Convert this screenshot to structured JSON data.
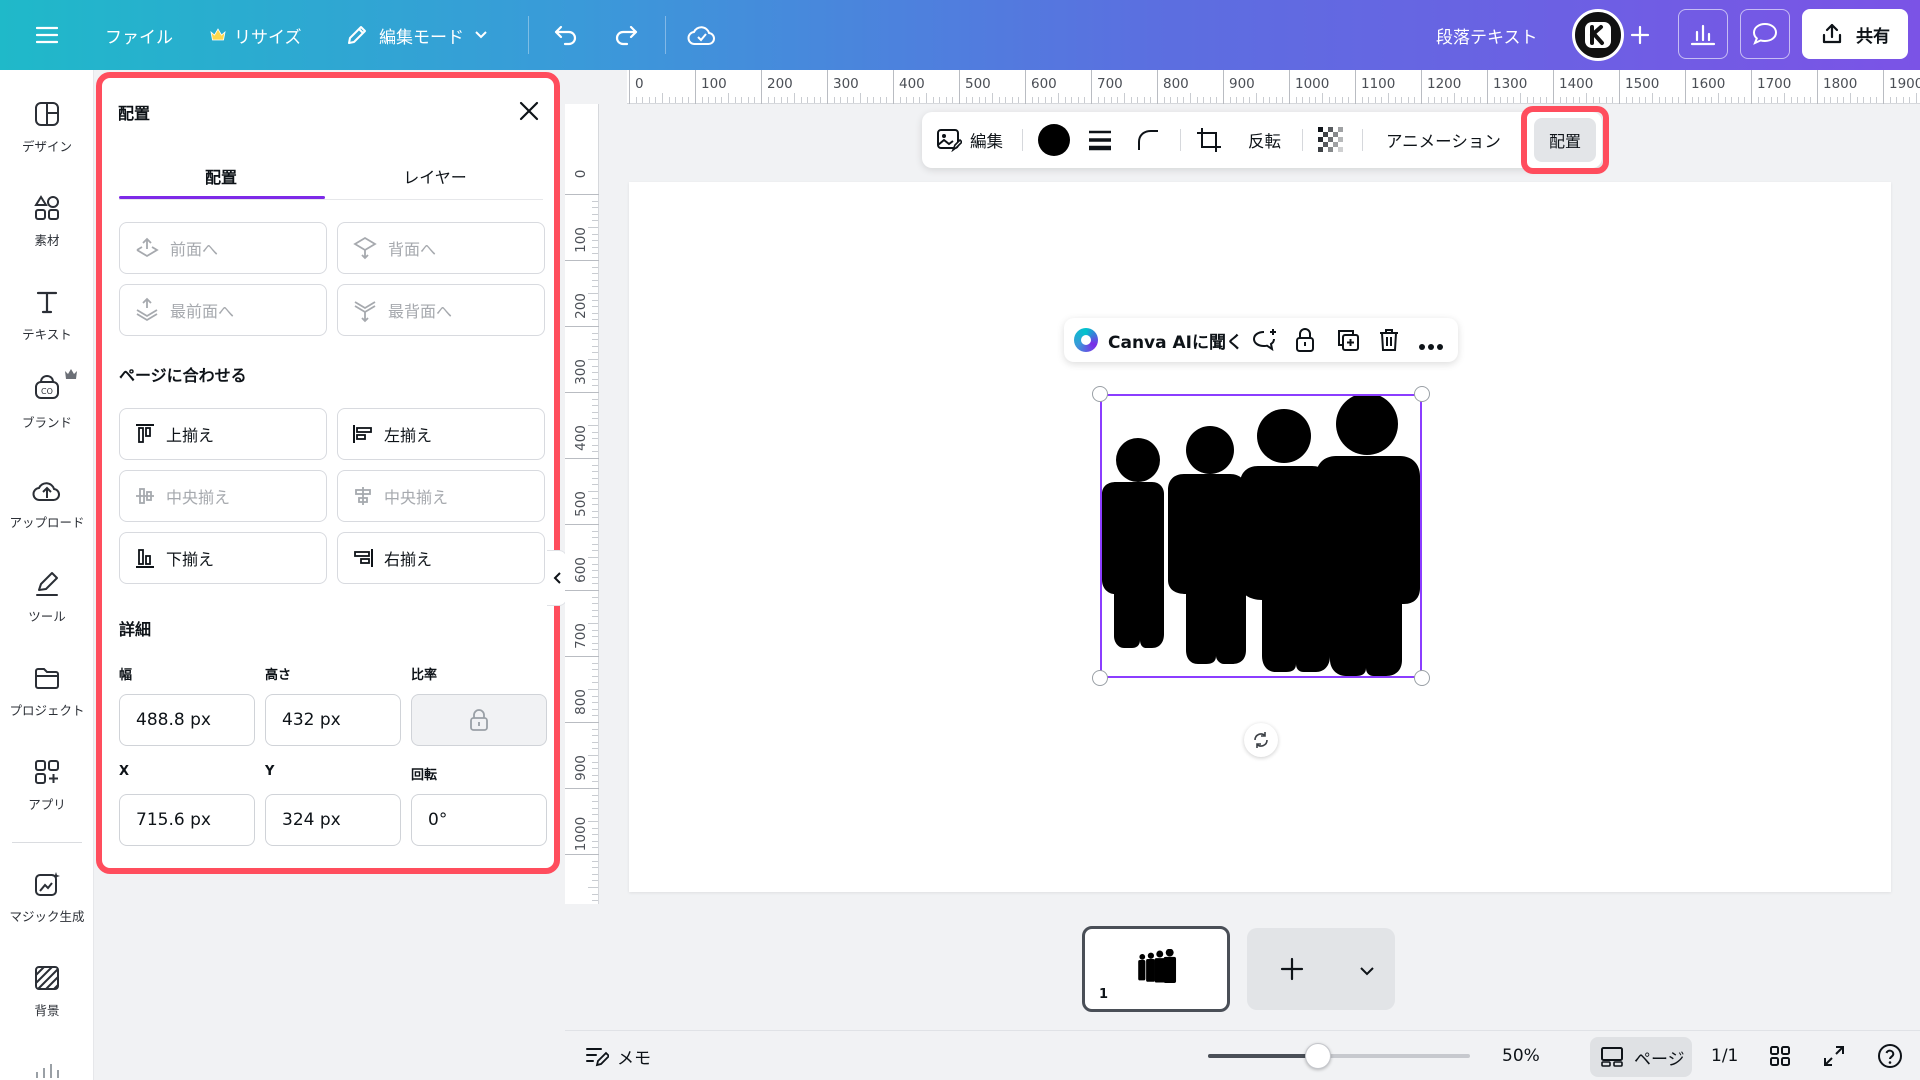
{
  "topbar": {
    "file_label": "ファイル",
    "resize_label": "リサイズ",
    "mode_label": "編集モード",
    "doc_title": "段落テキスト",
    "share_label": "共有"
  },
  "rail": {
    "items": [
      {
        "label": "デザイン",
        "icon": "design-icon"
      },
      {
        "label": "素材",
        "icon": "elements-icon"
      },
      {
        "label": "テキスト",
        "icon": "text-icon"
      },
      {
        "label": "ブランド",
        "icon": "brand-icon"
      },
      {
        "label": "アップロード",
        "icon": "upload-icon"
      },
      {
        "label": "ツール",
        "icon": "tools-icon"
      },
      {
        "label": "プロジェクト",
        "icon": "projects-icon"
      },
      {
        "label": "アプリ",
        "icon": "apps-icon"
      },
      {
        "label": "マジック生成",
        "icon": "magic-icon"
      },
      {
        "label": "背景",
        "icon": "background-icon"
      }
    ]
  },
  "panel": {
    "title": "配置",
    "tabs": [
      {
        "label": "配置",
        "active": true
      },
      {
        "label": "レイヤー",
        "active": false
      }
    ],
    "layer_buttons": [
      "前面へ",
      "背面へ",
      "最前面へ",
      "最背面へ"
    ],
    "align_title": "ページに合わせる",
    "align_buttons": [
      "上揃え",
      "左揃え",
      "中央揃え",
      "中央揃え",
      "下揃え",
      "右揃え"
    ],
    "details_title": "詳細",
    "fields": {
      "width_label": "幅",
      "width_value": "488.8 px",
      "height_label": "高さ",
      "height_value": "432 px",
      "ratio_label": "比率",
      "x_label": "X",
      "x_value": "715.6 px",
      "y_label": "Y",
      "y_value": "324 px",
      "rotation_label": "回転",
      "rotation_value": "0°"
    }
  },
  "ruler": {
    "top": [
      "0",
      "100",
      "200",
      "300",
      "400",
      "500",
      "600",
      "700",
      "800",
      "900",
      "1000",
      "1100",
      "1200",
      "1300",
      "1400",
      "1500",
      "1600",
      "1700",
      "1800",
      "1900"
    ],
    "left": [
      "0",
      "100",
      "200",
      "300",
      "400",
      "500",
      "600",
      "700",
      "800",
      "900",
      "1000"
    ]
  },
  "context_toolbar": {
    "edit_label": "編集",
    "flip_label": "反転",
    "animation_label": "アニメーション",
    "position_label": "配置",
    "color": "#000000"
  },
  "ai_bar": {
    "label": "Canva AIに聞く"
  },
  "pages": {
    "thumb_number": "1"
  },
  "footer": {
    "notes_label": "メモ",
    "zoom_value": "50%",
    "zoom_fraction": 0.42,
    "page_view_label": "ページ",
    "page_count": "1/1"
  },
  "colors": {
    "accent": "#7d2ae8",
    "highlight": "#ff4d5d",
    "selection": "#8b3dff"
  }
}
